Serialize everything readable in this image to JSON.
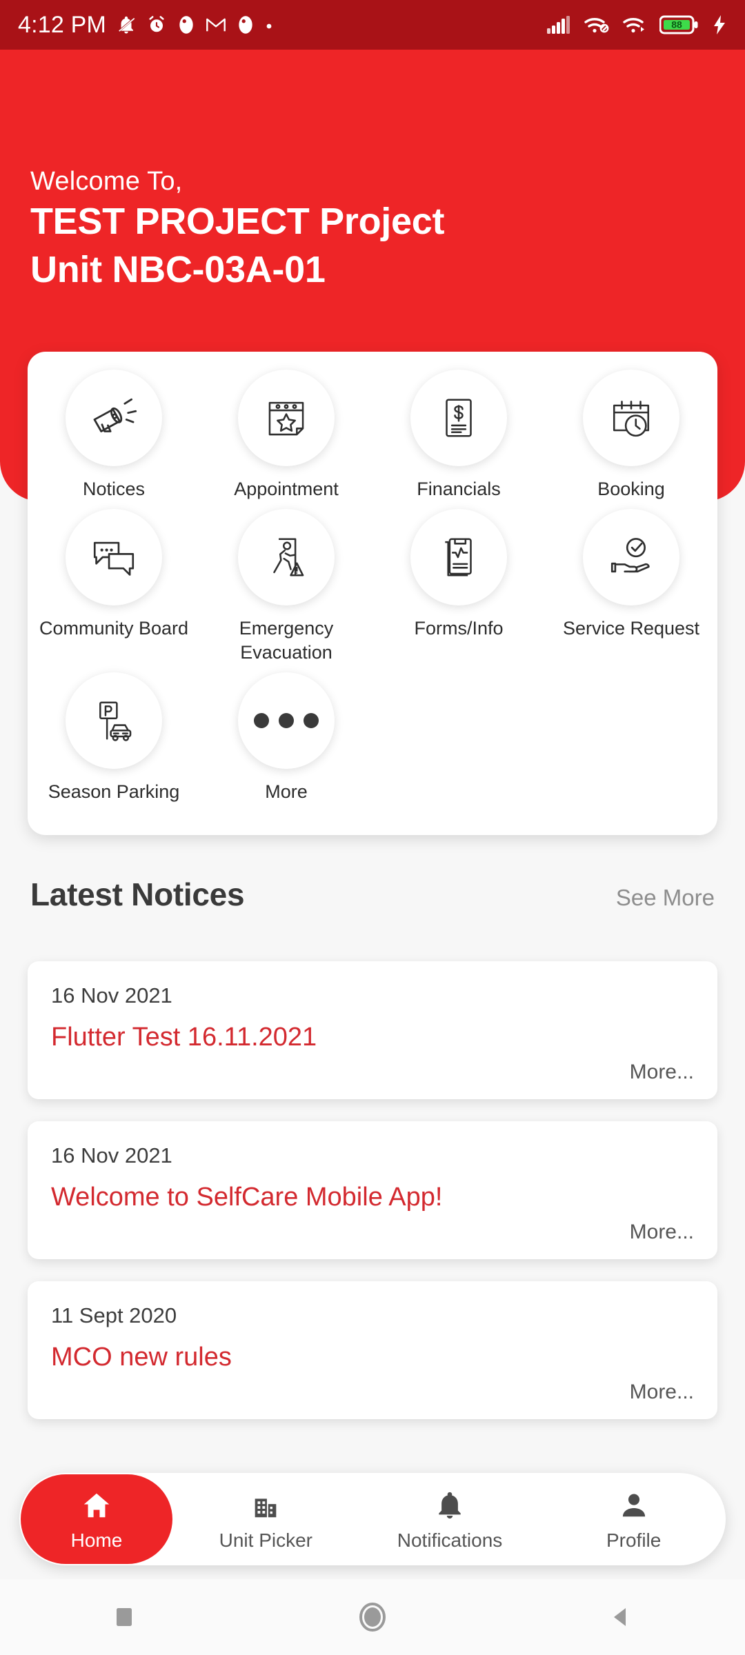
{
  "statusbar": {
    "time": "4:12 PM",
    "left_icons": [
      "notifications-silenced-icon",
      "alarm-icon",
      "app-badge-icon",
      "gmail-icon",
      "app-badge-icon",
      "dot-icon"
    ],
    "right_icons": [
      "cellular-signal-icon",
      "wifi-linked-icon",
      "wifi-icon",
      "battery-icon",
      "charging-bolt-icon"
    ],
    "battery_level": "88",
    "bg_color": "#a91217"
  },
  "header": {
    "welcome": "Welcome To,",
    "title_line1": "TEST PROJECT Project",
    "title_line2": "Unit NBC-03A-01",
    "bg_color": "#ee2527"
  },
  "menu": {
    "items": [
      {
        "label": "Notices",
        "icon": "megaphone-icon"
      },
      {
        "label": "Appointment",
        "icon": "calendar-star-icon"
      },
      {
        "label": "Financials",
        "icon": "dollar-document-icon"
      },
      {
        "label": "Booking",
        "icon": "calendar-clock-icon"
      },
      {
        "label": "Community Board",
        "icon": "chat-bubbles-icon"
      },
      {
        "label": "Emergency Evacuation",
        "icon": "running-exit-icon"
      },
      {
        "label": "Forms/Info",
        "icon": "clipboard-pulse-icon"
      },
      {
        "label": "Service Request",
        "icon": "hand-check-icon"
      },
      {
        "label": "Season Parking",
        "icon": "parking-car-icon"
      },
      {
        "label": "More",
        "icon": "three-dots-icon"
      }
    ]
  },
  "notices_section": {
    "title": "Latest Notices",
    "see_more": "See More",
    "more_label": "More...",
    "accent_color": "#d3292f",
    "items": [
      {
        "date": "16 Nov 2021",
        "title": "Flutter Test 16.11.2021",
        "more": "More..."
      },
      {
        "date": "16 Nov 2021",
        "title": "Welcome to SelfCare Mobile App!",
        "more": "More..."
      },
      {
        "date": "11 Sept 2020",
        "title": "MCO new rules",
        "more": "More..."
      }
    ]
  },
  "bottomnav": {
    "active_color": "#ee2527",
    "items": [
      {
        "label": "Home",
        "icon": "home-icon",
        "active": true
      },
      {
        "label": "Unit Picker",
        "icon": "building-icon",
        "active": false
      },
      {
        "label": "Notifications",
        "icon": "bell-icon",
        "active": false
      },
      {
        "label": "Profile",
        "icon": "person-icon",
        "active": false
      }
    ]
  },
  "androidnav": {
    "buttons": [
      {
        "name": "recents-button",
        "icon": "square-icon"
      },
      {
        "name": "home-button",
        "icon": "circle-icon"
      },
      {
        "name": "back-button",
        "icon": "triangle-left-icon"
      }
    ]
  }
}
